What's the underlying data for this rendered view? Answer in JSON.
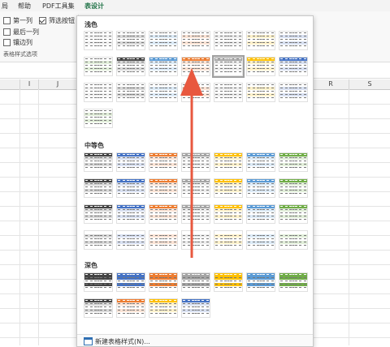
{
  "ribbon": {
    "tabs": [
      "局",
      "帮助",
      "PDF工具集",
      "表设计"
    ],
    "active_tab": "表设计",
    "options": [
      {
        "label": "第一列",
        "checked": false
      },
      {
        "label": "最后一列",
        "checked": false
      },
      {
        "label": "镶边列",
        "checked": false
      },
      {
        "label": "筛选按钮",
        "checked": true
      }
    ],
    "group_label": "表格样式选项"
  },
  "columns": [
    "I",
    "J",
    "R",
    "S"
  ],
  "gallery": {
    "sections": [
      {
        "title": "浅色"
      },
      {
        "title": "中等色"
      },
      {
        "title": "深色"
      }
    ],
    "new_style_label": "新建表格样式(N)..."
  },
  "colors": {
    "light_palette": [
      "#ffffff",
      "#444444",
      "#4472c4",
      "#ed7d31",
      "#a5a5a5",
      "#ffc000",
      "#5b9bd5",
      "#70ad47"
    ],
    "accent_green": "#1e7145",
    "arrow": "#e8583f"
  }
}
